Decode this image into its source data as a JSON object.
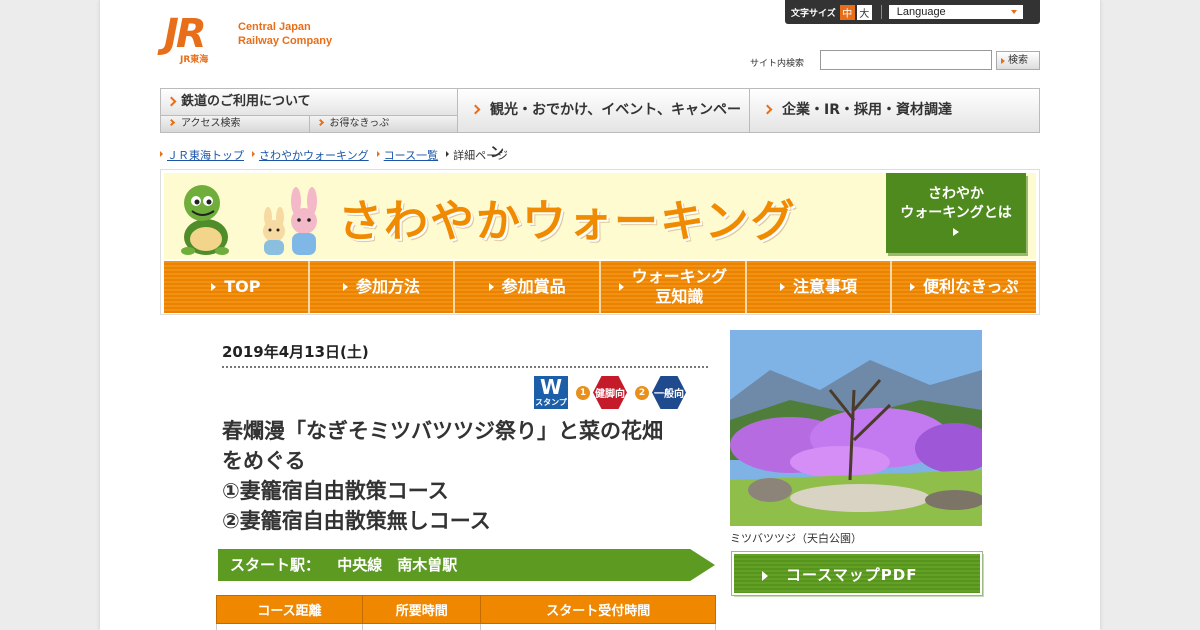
{
  "header": {
    "logo_mark": "JR",
    "logo_sub": "JR東海",
    "logo_line1": "Central Japan",
    "logo_line2": "Railway Company",
    "font_size_label": "文字サイズ",
    "font_size_mid": "中",
    "font_size_big": "大",
    "language": "Language",
    "search_label": "サイト内検索",
    "search_value": "",
    "search_button": "検索"
  },
  "gnav": {
    "rail": "鉄道のご利用について",
    "access": "アクセス検索",
    "tickets": "お得なきっぷ",
    "tourism": "観光・おでかけ、イベント、キャンペーン",
    "corporate": "企業・IR・採用・資材調達"
  },
  "breadcrumb": [
    "ＪＲ東海トップ",
    "さわやかウォーキング",
    "コース一覧",
    "詳細ページ"
  ],
  "banner": {
    "title": "さわやかウォーキング",
    "about_line1": "さわやか",
    "about_line2": "ウォーキングとは",
    "nav": [
      {
        "line1": "TOP",
        "line2": ""
      },
      {
        "line1": "参加方法",
        "line2": ""
      },
      {
        "line1": "参加賞品",
        "line2": ""
      },
      {
        "line1": "ウォーキング",
        "line2": "豆知識"
      },
      {
        "line1": "注意事項",
        "line2": ""
      },
      {
        "line1": "便利なきっぷ",
        "line2": ""
      }
    ]
  },
  "detail": {
    "date": "2019年4月13日(土)",
    "badge_w": "W",
    "badge_w_sub": "スタンプ",
    "num1": "1",
    "badge1": "健脚向",
    "num2": "2",
    "badge2": "一般向",
    "title_lines": [
      "春爛漫「なぎそミツバツツジ祭り」と菜の花畑",
      "をめぐる",
      "①妻籠宿自由散策コース",
      "②妻籠宿自由散策無しコース"
    ],
    "start_label": "スタート駅：",
    "start_station": "中央線　南木曽駅",
    "table_headers": [
      "コース距離",
      "所要時間",
      "スタート受付時間"
    ],
    "photo_caption": "ミツバツツジ（天白公園）",
    "pdf_button": "コースマップPDF"
  },
  "colors": {
    "brand_orange": "#e86e19",
    "nav_orange": "#f08a00",
    "green": "#5c9a22",
    "link_blue": "#1a55a8"
  }
}
